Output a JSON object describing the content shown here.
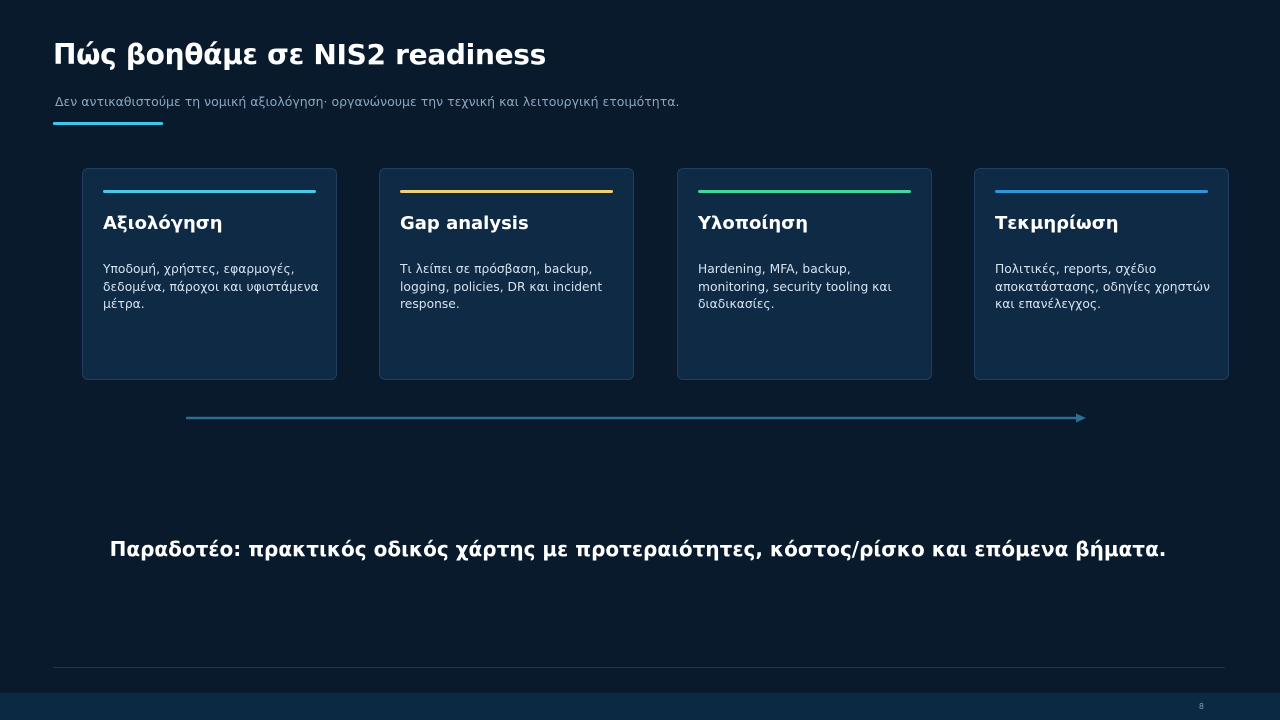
{
  "header": {
    "title": "Πώς βοηθάμε σε NIS2 readiness",
    "subtitle": "Δεν αντικαθιστούμε τη νομική αξιολόγηση· οργανώνουμε την τεχνική και λειτουργική ετοιμότητα."
  },
  "cards": [
    {
      "title": "Αξιολόγηση",
      "body": "Υποδομή, χρήστες, εφαρμογές, δεδομένα, πάροχοι και υφιστάμενα μέτρα.",
      "accent_color": "#4cc8ec"
    },
    {
      "title": "Gap analysis",
      "body": "Τι λείπει σε πρόσβαση, backup, logging, policies, DR και incident response.",
      "accent_color": "#f2cf72"
    },
    {
      "title": "Υλοποίηση",
      "body": "Hardening, MFA, backup, monitoring, security tooling και διαδικασίες.",
      "accent_color": "#46d59a"
    },
    {
      "title": "Τεκμηρίωση",
      "body": "Πολιτικές, reports, σχέδιο αποκατάστασης, οδηγίες χρηστών και επανέλεγχος.",
      "accent_color": "#2f97d6"
    }
  ],
  "deliverable": "Παραδοτέο: πρακτικός οδικός χάρτης με προτεραιότητες, κόστος/ρίσκο και επόμενα βήματα.",
  "footer": {
    "page_number": "8"
  },
  "colors": {
    "background": "#081a2b",
    "card_background": "#0e2a45",
    "title_underline": "#3fc6ea",
    "arrow": "#2d6e92"
  }
}
